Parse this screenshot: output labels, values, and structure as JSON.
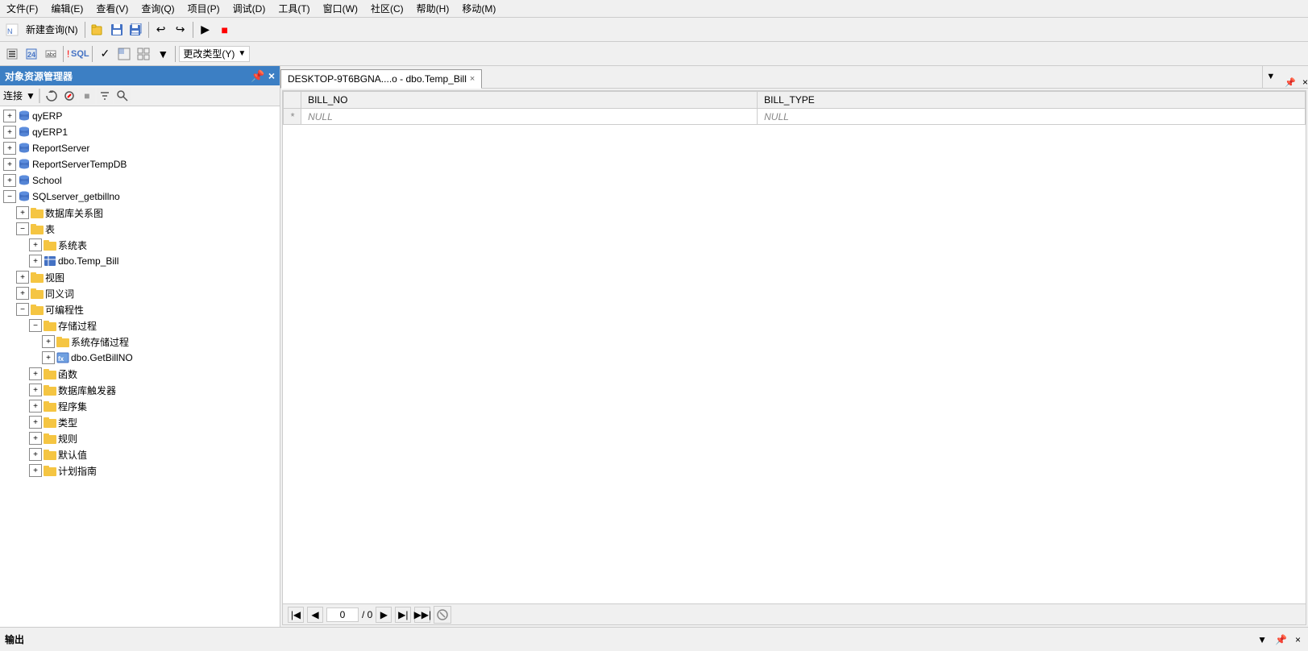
{
  "menubar": {
    "items": [
      "文件(F)",
      "编辑(E)",
      "查看(V)",
      "查询(Q)",
      "项目(P)",
      "调试(D)",
      "工具(T)",
      "窗口(W)",
      "社区(C)",
      "帮助(H)",
      "移动(M)"
    ]
  },
  "toolbar1": {
    "new_query": "新建查询(N)",
    "change_type_label": "更改类型(Y)",
    "sql_label": "SQL"
  },
  "object_explorer": {
    "title": "对象资源管理器",
    "connect_label": "连接",
    "tree": [
      {
        "id": "qyERP",
        "label": "qyERP",
        "level": 0,
        "expanded": false,
        "icon": "database"
      },
      {
        "id": "qyERP1",
        "label": "qyERP1",
        "level": 0,
        "expanded": false,
        "icon": "database"
      },
      {
        "id": "ReportServer",
        "label": "ReportServer",
        "level": 0,
        "expanded": false,
        "icon": "database"
      },
      {
        "id": "ReportServerTempDB",
        "label": "ReportServerTempDB",
        "level": 0,
        "expanded": false,
        "icon": "database"
      },
      {
        "id": "School",
        "label": "School",
        "level": 0,
        "expanded": false,
        "icon": "database"
      },
      {
        "id": "SQLserver_getbillno",
        "label": "SQLserver_getbillno",
        "level": 0,
        "expanded": true,
        "icon": "database"
      },
      {
        "id": "db_diagram",
        "label": "数据库关系图",
        "level": 1,
        "expanded": false,
        "icon": "folder"
      },
      {
        "id": "tables",
        "label": "表",
        "level": 1,
        "expanded": true,
        "icon": "folder"
      },
      {
        "id": "sys_tables",
        "label": "系统表",
        "level": 2,
        "expanded": false,
        "icon": "folder"
      },
      {
        "id": "dbo_temp_bill",
        "label": "dbo.Temp_Bill",
        "level": 2,
        "expanded": false,
        "icon": "table"
      },
      {
        "id": "views",
        "label": "视图",
        "level": 1,
        "expanded": false,
        "icon": "folder"
      },
      {
        "id": "synonyms",
        "label": "同义词",
        "level": 1,
        "expanded": false,
        "icon": "folder"
      },
      {
        "id": "programmability",
        "label": "可编程性",
        "level": 1,
        "expanded": true,
        "icon": "folder"
      },
      {
        "id": "stored_procs",
        "label": "存储过程",
        "level": 2,
        "expanded": true,
        "icon": "folder"
      },
      {
        "id": "sys_stored_procs",
        "label": "系统存储过程",
        "level": 3,
        "expanded": false,
        "icon": "folder"
      },
      {
        "id": "dbo_getbillno",
        "label": "dbo.GetBillNO",
        "level": 3,
        "expanded": false,
        "icon": "proc"
      },
      {
        "id": "functions",
        "label": "函数",
        "level": 2,
        "expanded": false,
        "icon": "folder"
      },
      {
        "id": "db_triggers",
        "label": "数据库触发器",
        "level": 2,
        "expanded": false,
        "icon": "folder"
      },
      {
        "id": "assemblies",
        "label": "程序集",
        "level": 2,
        "expanded": false,
        "icon": "folder"
      },
      {
        "id": "types",
        "label": "类型",
        "level": 2,
        "expanded": false,
        "icon": "folder"
      },
      {
        "id": "rules",
        "label": "规则",
        "level": 2,
        "expanded": false,
        "icon": "folder"
      },
      {
        "id": "defaults",
        "label": "默认值",
        "level": 2,
        "expanded": false,
        "icon": "folder"
      },
      {
        "id": "plan_guides",
        "label": "计划指南",
        "level": 2,
        "expanded": false,
        "icon": "folder"
      }
    ]
  },
  "tab": {
    "title": "DESKTOP-9T6BGNA....o - dbo.Temp_Bill",
    "close_label": "×"
  },
  "results": {
    "columns": [
      "BILL_NO",
      "BILL_TYPE"
    ],
    "rows": [
      {
        "indicator": "*",
        "bill_no": "NULL",
        "bill_type": "NULL"
      }
    ]
  },
  "navigation": {
    "current_page": "0",
    "total_pages": "/ 0"
  },
  "output_panel": {
    "label": "输出"
  }
}
